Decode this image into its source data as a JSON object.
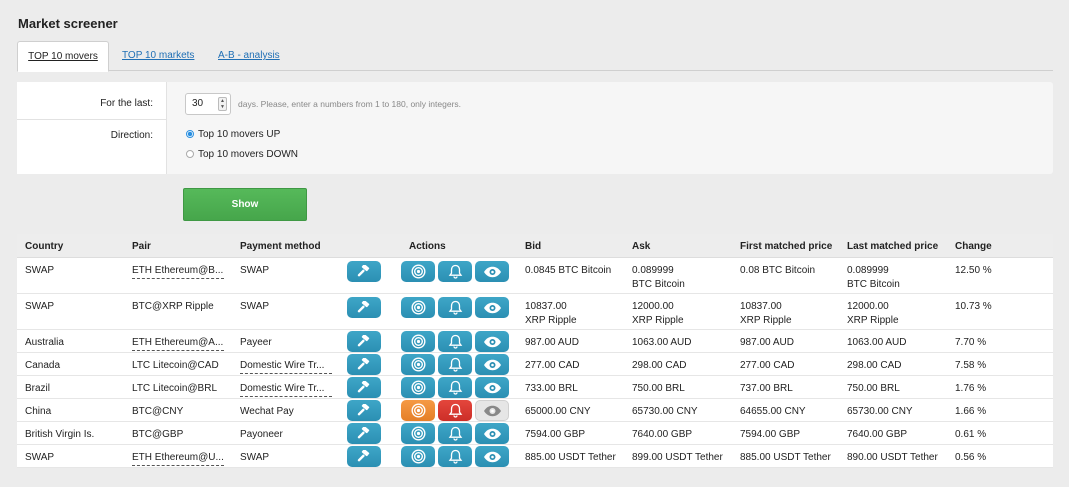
{
  "page_title": "Market screener",
  "tabs": [
    {
      "label": "TOP 10 movers"
    },
    {
      "label": "TOP 10 markets"
    },
    {
      "label": "A-B - analysis"
    }
  ],
  "form": {
    "period_label": "For the last:",
    "period_value": "30",
    "period_hint": "days. Please, enter a numbers from 1 to 180, only integers.",
    "direction_label": "Direction:",
    "option_up": "Top 10 movers UP",
    "option_down": "Top 10 movers DOWN",
    "selected_option": "up"
  },
  "show_button": "Show",
  "table": {
    "headers": {
      "country": "Country",
      "pair": "Pair",
      "payment": "Payment method",
      "actions": "Actions",
      "bid": "Bid",
      "ask": "Ask",
      "first": "First matched price",
      "last": "Last matched price",
      "change": "Change"
    },
    "rows": [
      {
        "country": "SWAP",
        "pair": "ETH Ethereum@B...",
        "pair_link": true,
        "payment": "SWAP",
        "payment_link": false,
        "bid": [
          "0.0845 BTC Bitcoin"
        ],
        "ask": [
          "0.089999",
          "BTC Bitcoin"
        ],
        "first": [
          "0.08 BTC Bitcoin"
        ],
        "last": [
          "0.089999",
          "BTC Bitcoin"
        ],
        "change": "12.50 %",
        "style": "teal"
      },
      {
        "country": "SWAP",
        "pair": "BTC@XRP Ripple",
        "pair_link": false,
        "payment": "SWAP",
        "payment_link": false,
        "bid": [
          "10837.00",
          "XRP Ripple"
        ],
        "ask": [
          "12000.00",
          "XRP Ripple"
        ],
        "first": [
          "10837.00",
          "XRP Ripple"
        ],
        "last": [
          "12000.00",
          "XRP Ripple"
        ],
        "change": "10.73 %",
        "style": "teal"
      },
      {
        "country": "Australia",
        "pair": "ETH Ethereum@A...",
        "pair_link": true,
        "payment": "Payeer",
        "payment_link": false,
        "bid": [
          "987.00 AUD"
        ],
        "ask": [
          "1063.00 AUD"
        ],
        "first": [
          "987.00 AUD"
        ],
        "last": [
          "1063.00 AUD"
        ],
        "change": "7.70 %",
        "style": "teal"
      },
      {
        "country": "Canada",
        "pair": "LTC Litecoin@CAD",
        "pair_link": false,
        "payment": "Domestic Wire Tr...",
        "payment_link": true,
        "bid": [
          "277.00 CAD"
        ],
        "ask": [
          "298.00 CAD"
        ],
        "first": [
          "277.00 CAD"
        ],
        "last": [
          "298.00 CAD"
        ],
        "change": "7.58 %",
        "style": "teal"
      },
      {
        "country": "Brazil",
        "pair": "LTC Litecoin@BRL",
        "pair_link": false,
        "payment": "Domestic Wire Tr...",
        "payment_link": true,
        "bid": [
          "733.00 BRL"
        ],
        "ask": [
          "750.00 BRL"
        ],
        "first": [
          "737.00 BRL"
        ],
        "last": [
          "750.00 BRL"
        ],
        "change": "1.76 %",
        "style": "teal"
      },
      {
        "country": "China",
        "pair": "BTC@CNY",
        "pair_link": false,
        "payment": "Wechat Pay",
        "payment_link": false,
        "bid": [
          "65000.00 CNY"
        ],
        "ask": [
          "65730.00 CNY"
        ],
        "first": [
          "64655.00 CNY"
        ],
        "last": [
          "65730.00 CNY"
        ],
        "change": "1.66 %",
        "style": "active"
      },
      {
        "country": "British Virgin Is.",
        "pair": "BTC@GBP",
        "pair_link": false,
        "payment": "Payoneer",
        "payment_link": false,
        "bid": [
          "7594.00 GBP"
        ],
        "ask": [
          "7640.00 GBP"
        ],
        "first": [
          "7594.00 GBP"
        ],
        "last": [
          "7640.00 GBP"
        ],
        "change": "0.61 %",
        "style": "teal"
      },
      {
        "country": "SWAP",
        "pair": "ETH Ethereum@U...",
        "pair_link": true,
        "payment": "SWAP",
        "payment_link": false,
        "bid": [
          "885.00 USDT Tether"
        ],
        "ask": [
          "899.00 USDT Tether"
        ],
        "first": [
          "885.00 USDT Tether"
        ],
        "last": [
          "890.00 USDT Tether"
        ],
        "change": "0.56 %",
        "style": "teal"
      }
    ]
  },
  "icons": {
    "trade": "gavel-icon",
    "target": "target-icon",
    "alert": "bell-icon",
    "watch": "eye-icon"
  },
  "colors": {
    "accent_teal": "#2b8fb3",
    "show_green": "#4caf50",
    "active_orange": "#e57f27",
    "active_red": "#cc2e28",
    "link_blue": "#1f6fb5"
  }
}
